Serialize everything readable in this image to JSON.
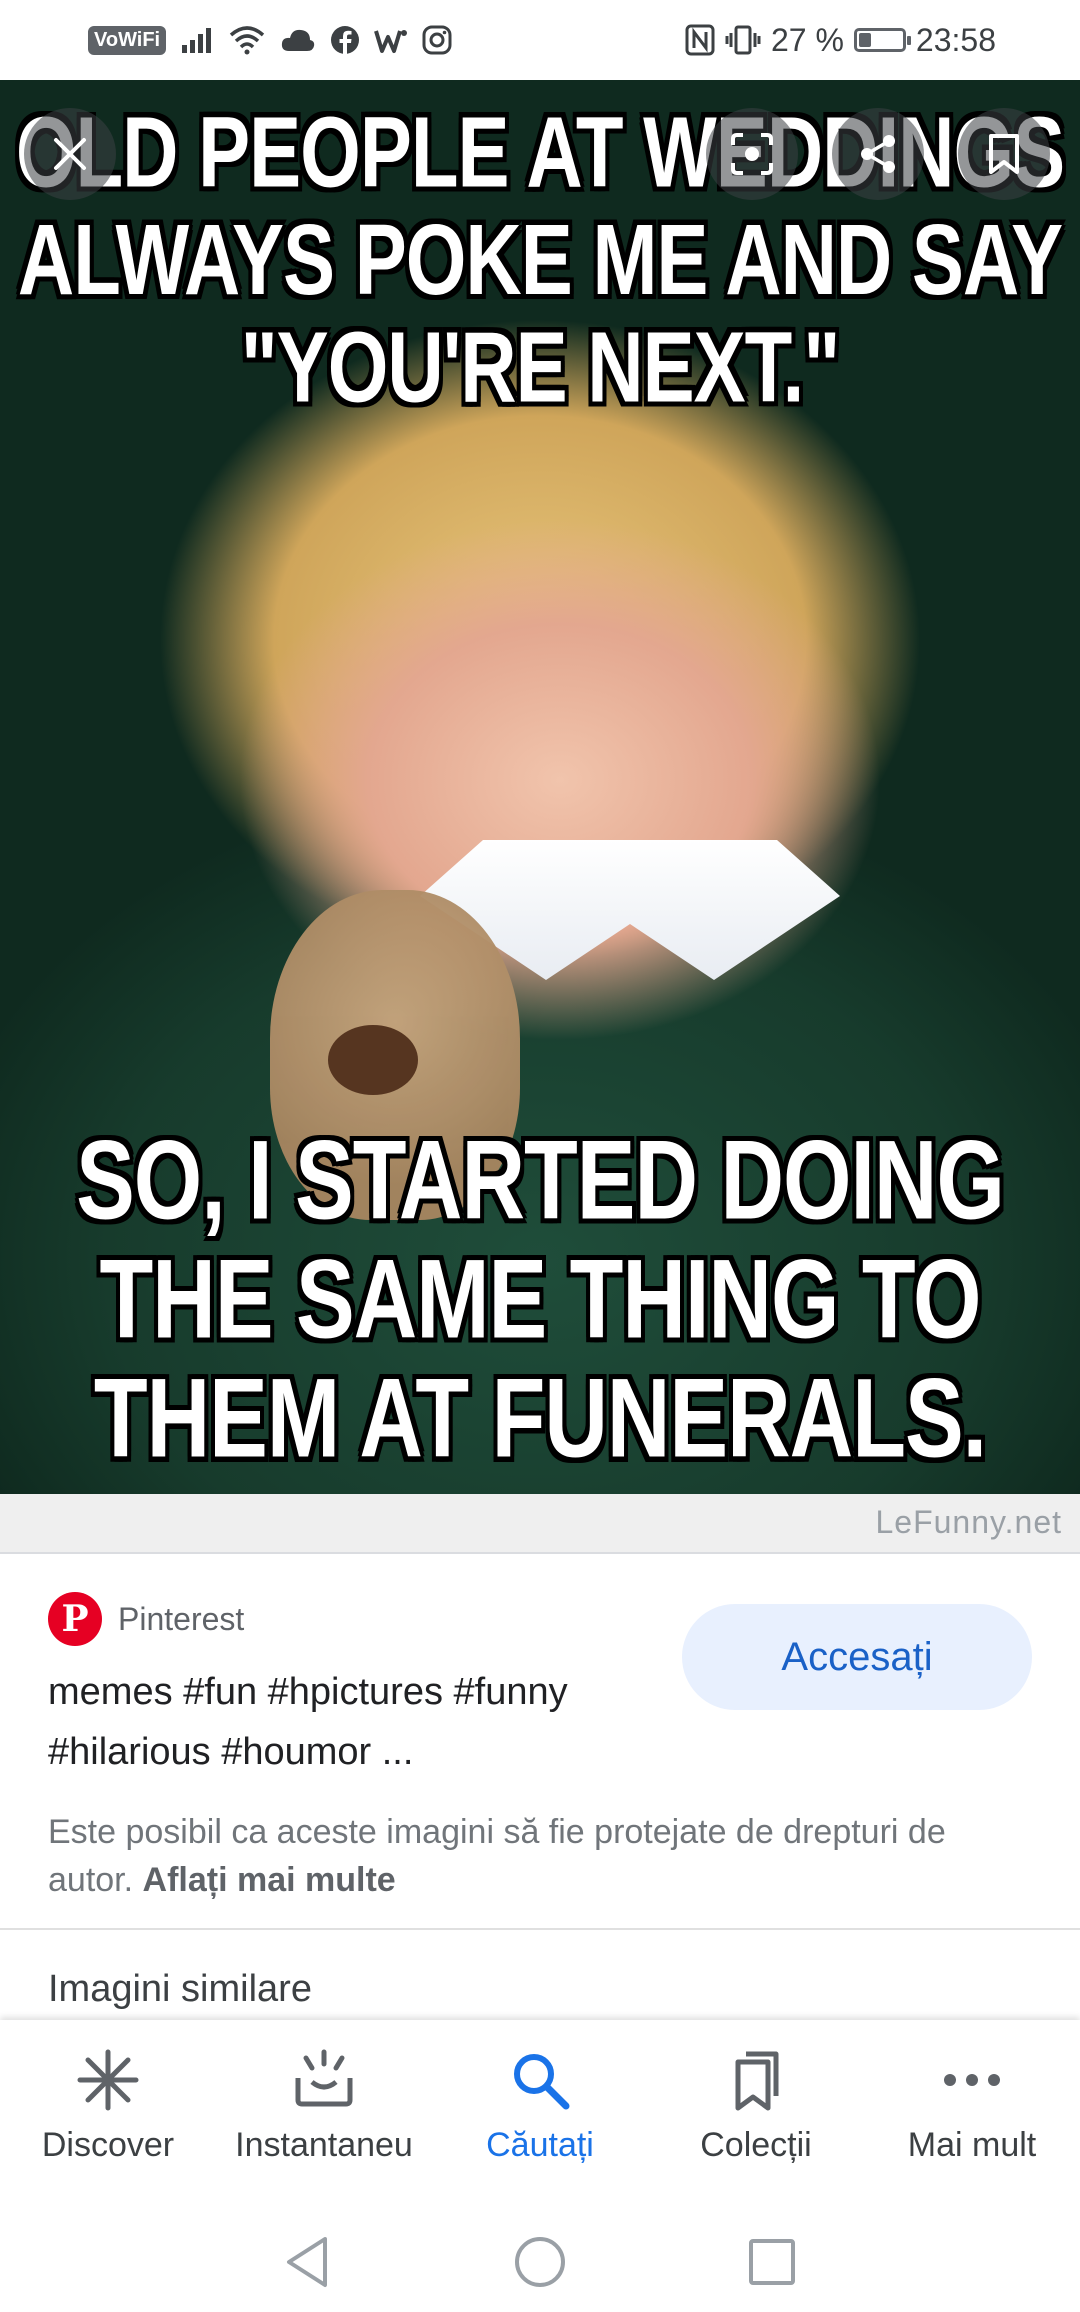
{
  "status_bar": {
    "vowifi": "VoWiFi",
    "battery_text": "27 %",
    "battery_level": 0.27,
    "time": "23:58",
    "icons": [
      "signal-icon",
      "wifi-icon",
      "cloud-icon",
      "facebook-icon",
      "webtoon-icon",
      "instagram-icon",
      "nfc-icon",
      "vibrate-icon",
      "battery-icon"
    ]
  },
  "image": {
    "caption_top": [
      "OLD PEOPLE AT WEDDINGS",
      "ALWAYS POKE ME AND SAY",
      "\"YOU'RE NEXT.\""
    ],
    "caption_bottom": [
      "SO, I STARTED DOING",
      "THE SAME THING TO",
      "THEM AT FUNERALS."
    ],
    "watermark": "LeFunny.net",
    "overlay_buttons": [
      "close-icon",
      "lens-icon",
      "share-icon",
      "bookmark-icon"
    ]
  },
  "result": {
    "source": "Pinterest",
    "title": "memes #fun #hpictures #funny #hilarious #houmor ...",
    "visit_label": "Accesați",
    "copyright_text": "Este posibil ca aceste imagini să fie protejate de drepturi de autor.",
    "learn_more": "Aflați mai multe",
    "similar_heading": "Imagini similare"
  },
  "bottom_nav": {
    "items": [
      {
        "label": "Discover",
        "icon": "asterisk-icon"
      },
      {
        "label": "Instantaneu",
        "icon": "snapshot-icon"
      },
      {
        "label": "Căutați",
        "icon": "search-icon"
      },
      {
        "label": "Colecții",
        "icon": "collections-icon"
      },
      {
        "label": "Mai mult",
        "icon": "more-icon"
      }
    ],
    "active": "Căutați"
  },
  "colors": {
    "accent": "#1a73e8",
    "visit_button_bg": "#e8f0fe",
    "pinterest": "#e60023"
  }
}
